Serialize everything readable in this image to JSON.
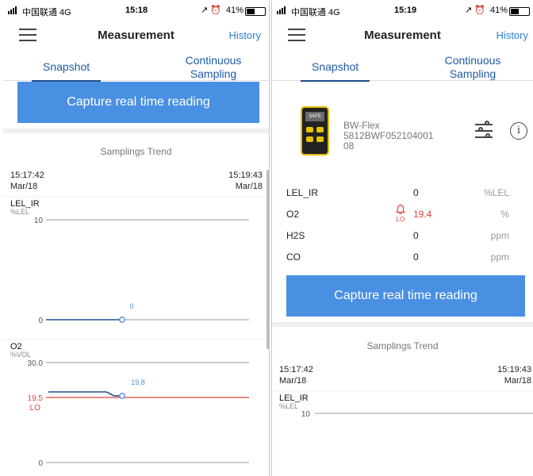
{
  "left": {
    "status": {
      "carrier": "中国联通 4G",
      "time": "15:18",
      "icons": "↗ ⏰",
      "battery": "41%"
    },
    "header": {
      "title": "Measurement",
      "history": "History"
    },
    "tabs": {
      "snapshot": "Snapshot",
      "continuous_line1": "Continuous",
      "continuous_line2": "Sampling"
    },
    "capture_button": "Capture real time reading",
    "trend": {
      "title": "Samplings Trend",
      "start_time": "15:17:42",
      "start_date": "Mar/18",
      "end_time": "15:19:43",
      "end_date": "Mar/18"
    },
    "charts": [
      {
        "name": "LEL_IR",
        "unit": "%LEL",
        "ymax_label": "10",
        "y0_label": "0",
        "point_label": "0",
        "point_value": 0
      },
      {
        "name": "O2",
        "unit": "%VOL",
        "ymax_label": "30.0",
        "alarm_label": "19.5",
        "alarm_tag": "LO",
        "y0_label": "0",
        "point_label": "19.8",
        "point_value": 19.8
      }
    ]
  },
  "right": {
    "status": {
      "carrier": "中国联通 4G",
      "time": "15:19",
      "icons": "↗ ⏰",
      "battery": "41%"
    },
    "header": {
      "title": "Measurement",
      "history": "History"
    },
    "tabs": {
      "snapshot": "Snapshot",
      "continuous_line1": "Continuous",
      "continuous_line2": "Sampling"
    },
    "device": {
      "model": "BW-Flex",
      "serial_line1": "5812BWF052104001",
      "serial_line2": "08",
      "screen_label": "SAFE"
    },
    "gases": [
      {
        "name": "LEL_IR",
        "value": "0",
        "unit": "%LEL"
      },
      {
        "name": "O2",
        "value": "19.4",
        "unit": "%",
        "alarm": "LO"
      },
      {
        "name": "H2S",
        "value": "0",
        "unit": "ppm"
      },
      {
        "name": "CO",
        "value": "0",
        "unit": "ppm"
      }
    ],
    "capture_button": "Capture real time reading",
    "trend": {
      "title": "Samplings Trend",
      "start_time": "15:17:42",
      "start_date": "Mar/18",
      "end_time": "15:19:43",
      "end_date": "Mar/18"
    },
    "charts": [
      {
        "name": "LEL_IR",
        "unit": "%LEL",
        "ymax_label": "10"
      }
    ]
  },
  "colors": {
    "accent": "#4a90e2",
    "tab": "#1f5aa6",
    "alarm": "#e0433a",
    "series": "#1f4e8c",
    "history": "#2a7fd4"
  }
}
